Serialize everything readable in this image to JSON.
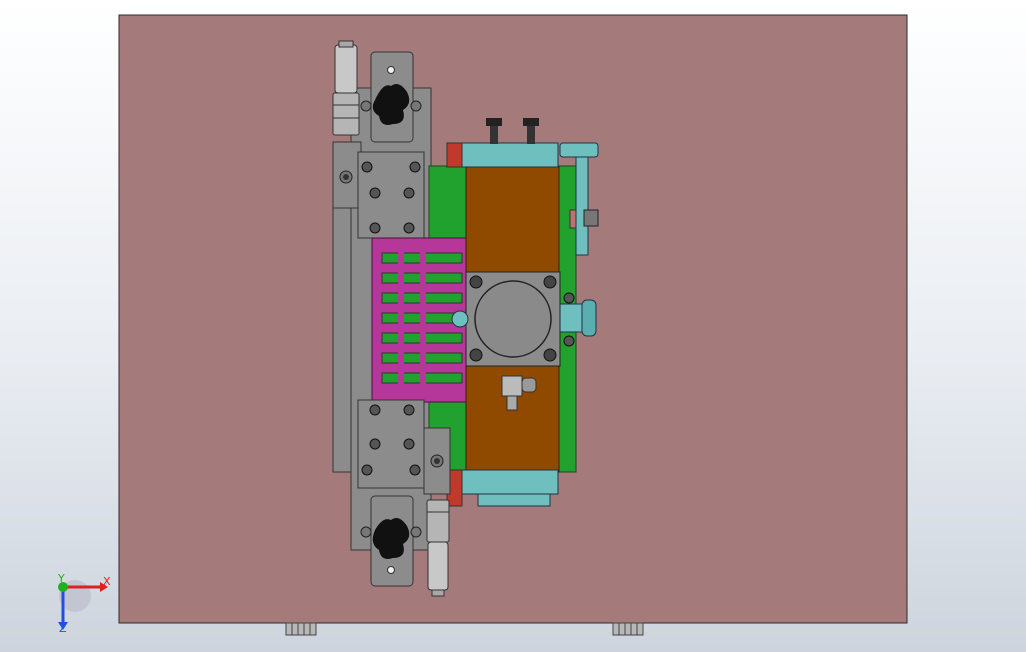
{
  "app": {
    "view": "cad-3d-viewport"
  },
  "colors": {
    "background_top": "#ffffff",
    "background_bottom": "#cdd4dd",
    "base_plate": "#a47a7a",
    "frame_gray": "#8c8c8c",
    "frame_dark": "#6f6f6f",
    "green_block": "#21a12d",
    "orange_block": "#8f4a00",
    "teal_part": "#6fbfbf",
    "magenta_slots": "#b5379a",
    "red_accent": "#c0392b"
  },
  "triad": {
    "x_label": "X",
    "y_label": "Y",
    "z_label": "Z",
    "x_color": "#e02020",
    "y_color": "#20b020",
    "z_color": "#2050e0"
  }
}
